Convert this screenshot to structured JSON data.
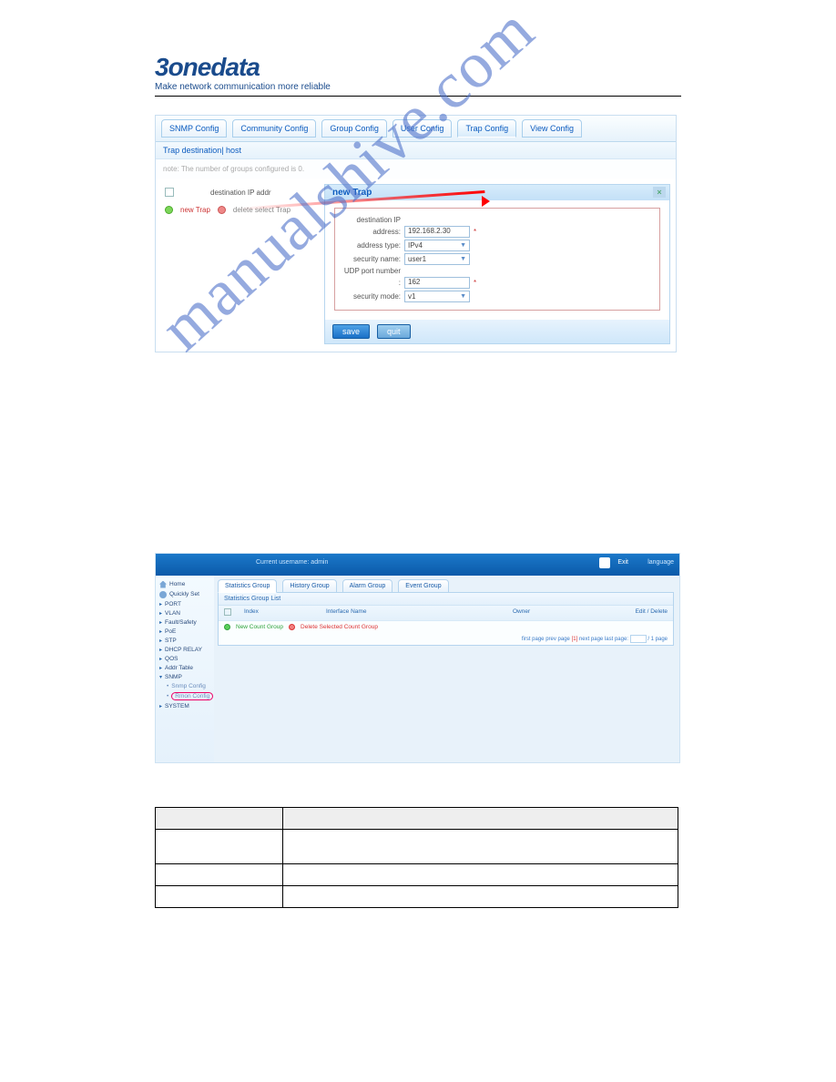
{
  "logo": {
    "brand": "3onedata",
    "tagline": "Make network communication more reliable"
  },
  "shot1": {
    "tabs": [
      "SNMP Config",
      "Community Config",
      "Group Config",
      "User Config",
      "Trap Config",
      "View Config"
    ],
    "active_tab": 4,
    "subtitle": "Trap destination| host",
    "note": "note:  The number of groups configured is 0.",
    "left_header": "destination IP addr",
    "new_trap": "new Trap",
    "del_trap": "delete select Trap",
    "modal": {
      "title": "new Trap",
      "fields": {
        "dest_ip_label": "destination IP",
        "address_label": "address:",
        "address_value": "192.168.2.30",
        "addr_type_label": "address type:",
        "addr_type_value": "IPv4",
        "sec_name_label": "security name:",
        "sec_name_value": "user1",
        "udp_label": "UDP port number",
        "udp_blank": ":",
        "udp_value": "162",
        "sec_mode_label": "security mode:",
        "sec_mode_value": "v1"
      },
      "save": "save",
      "quit": "quit"
    }
  },
  "shot2": {
    "current_user": "Current username: admin",
    "exit": "Exit",
    "language": "language",
    "sidebar": [
      {
        "label": "Home",
        "type": "icon-house"
      },
      {
        "label": "Quickly Set",
        "type": "icon-gear"
      },
      {
        "label": "PORT",
        "type": "caret"
      },
      {
        "label": "VLAN",
        "type": "caret"
      },
      {
        "label": "Fault/Safety",
        "type": "caret"
      },
      {
        "label": "PoE",
        "type": "caret"
      },
      {
        "label": "STP",
        "type": "caret"
      },
      {
        "label": "DHCP RELAY",
        "type": "caret"
      },
      {
        "label": "QOS",
        "type": "caret"
      },
      {
        "label": "Addr Table",
        "type": "caret"
      },
      {
        "label": "SNMP",
        "type": "caret-open"
      },
      {
        "label": "Snmp Config",
        "type": "sub"
      },
      {
        "label": "Rmon Config",
        "type": "sub-circled"
      },
      {
        "label": "SYSTEM",
        "type": "caret"
      }
    ],
    "tabs": [
      "Statistics Group",
      "History Group",
      "Alarm Group",
      "Event Group"
    ],
    "active_tab": 0,
    "panel_title": "Statistics Group List",
    "cols": [
      "",
      "Index",
      "Interface Name",
      "Owner",
      "Edit / Delete"
    ],
    "action_new": "New Count Group",
    "action_del": "Delete Selected Count Group",
    "pager": {
      "first": "first page",
      "prev": "prev page",
      "cur": "[1]",
      "next": "next page",
      "last": "last page:",
      "total": "/ 1 page"
    }
  },
  "watermark": "manualshive.com",
  "chart_data": {
    "type": "table",
    "rows": 3,
    "cols": 2,
    "header_row": true,
    "cells": [
      [
        "",
        ""
      ],
      [
        "",
        ""
      ],
      [
        "",
        ""
      ]
    ]
  }
}
